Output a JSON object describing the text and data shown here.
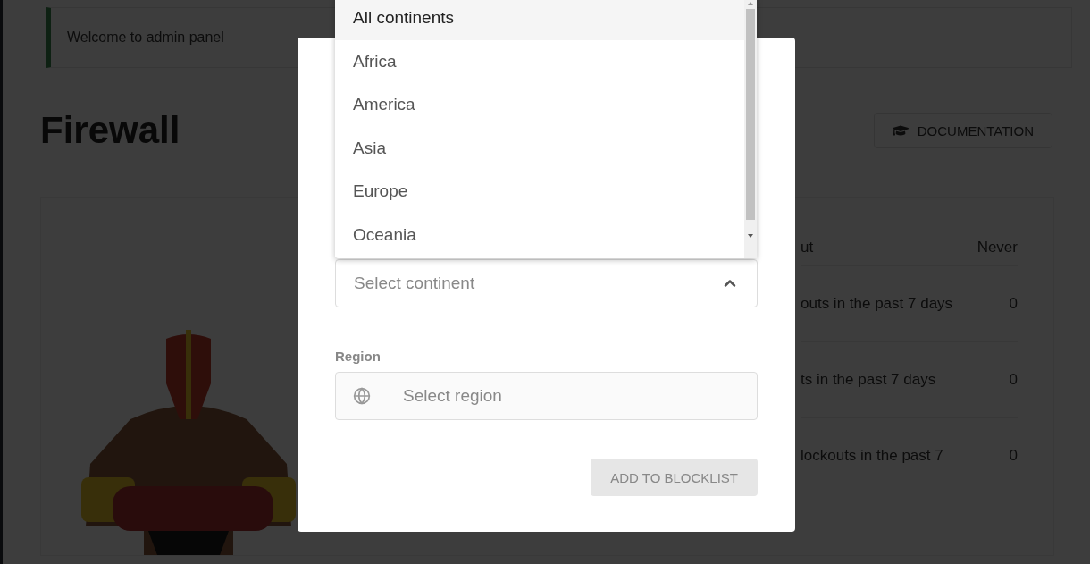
{
  "banner": {
    "text": "Welcome to admin panel"
  },
  "page": {
    "title": "Firewall",
    "documentation_button": "DOCUMENTATION"
  },
  "stats": [
    {
      "label": "ut",
      "value": "Never"
    },
    {
      "label": "outs in the past 7 days",
      "value": "0"
    },
    {
      "label": "ts in the past 7 days",
      "value": "0"
    },
    {
      "label": "lockouts in the past 7",
      "value": "0"
    }
  ],
  "modal": {
    "continent_field": {
      "placeholder": "Select continent",
      "expanded": true
    },
    "continent_options": [
      {
        "label": "All continents",
        "selected": true
      },
      {
        "label": "Africa",
        "selected": false
      },
      {
        "label": "America",
        "selected": false
      },
      {
        "label": "Asia",
        "selected": false
      },
      {
        "label": "Europe",
        "selected": false
      },
      {
        "label": "Oceania",
        "selected": false
      }
    ],
    "region_label": "Region",
    "region_field": {
      "placeholder": "Select region"
    },
    "submit_button": {
      "label": "ADD TO BLOCKLIST",
      "disabled": true
    }
  }
}
